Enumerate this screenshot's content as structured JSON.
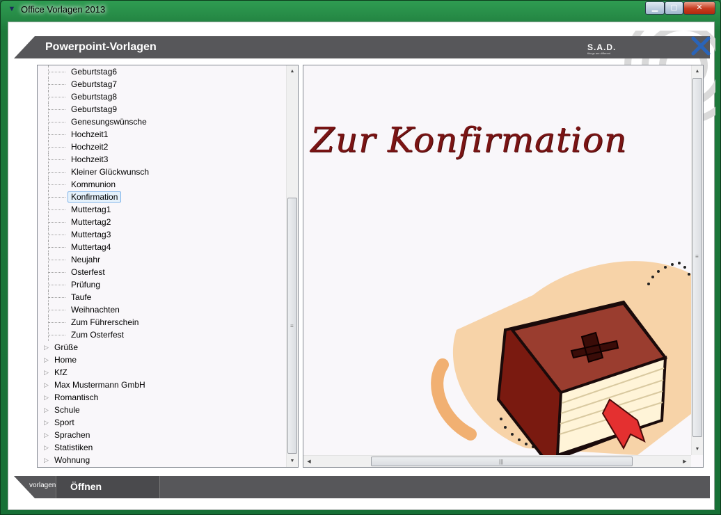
{
  "window": {
    "title": "Office Vorlagen 2013",
    "min_glyph": "▁",
    "max_glyph": "▢",
    "close_glyph": "✕",
    "sys_glyph": "▼"
  },
  "banner": {
    "title": "Powerpoint-Vorlagen",
    "logo": "S.A.D.",
    "logo_tagline": "things are different"
  },
  "tree": {
    "children": [
      "Geburtstag6",
      "Geburtstag7",
      "Geburtstag8",
      "Geburtstag9",
      "Genesungswünsche",
      "Hochzeit1",
      "Hochzeit2",
      "Hochzeit3",
      "Kleiner Glückwunsch",
      "Kommunion",
      "Konfirmation",
      "Muttertag1",
      "Muttertag2",
      "Muttertag3",
      "Muttertag4",
      "Neujahr",
      "Osterfest",
      "Prüfung",
      "Taufe",
      "Weihnachten",
      "Zum Führerschein",
      "Zum Osterfest"
    ],
    "selected": "Konfirmation",
    "folders": [
      "Grüße",
      "Home",
      "KfZ",
      "Max Mustermann GmbH",
      "Romantisch",
      "Schule",
      "Sport",
      "Sprachen",
      "Statistiken",
      "Wohnung"
    ]
  },
  "preview": {
    "heading": "Zur Konfirmation"
  },
  "footer": {
    "tab_label": "vorlagen",
    "open_label": "Öffnen"
  },
  "colors": {
    "banner": "#57575a",
    "heading": "#7a1414",
    "selection": "#e5f1fb",
    "close_x": "#2a64b8"
  }
}
